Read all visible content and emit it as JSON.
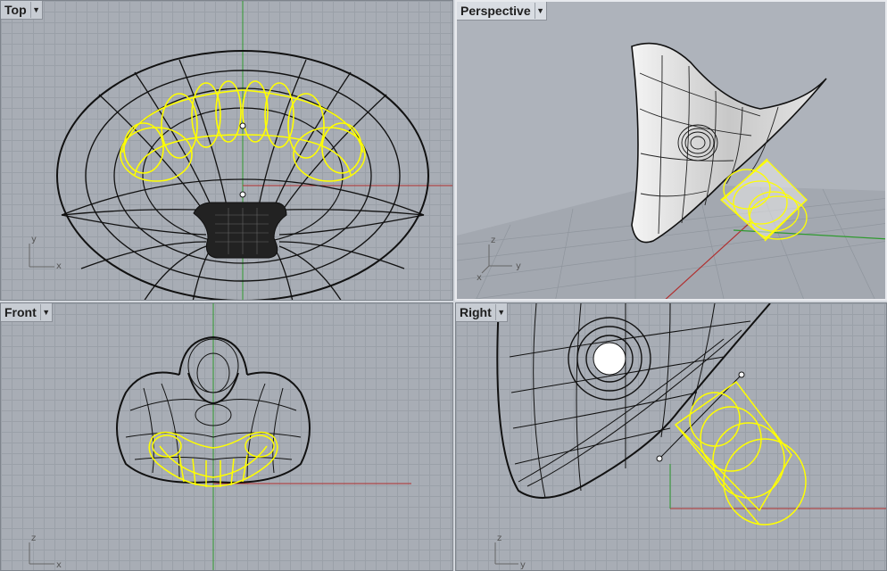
{
  "viewports": {
    "top": {
      "label": "Top",
      "menu_icon": "chevron-down-icon",
      "axes": [
        "y",
        "x"
      ]
    },
    "perspective": {
      "label": "Perspective",
      "menu_icon": "chevron-down-icon",
      "axes": [
        "z",
        "y",
        "x"
      ]
    },
    "front": {
      "label": "Front",
      "menu_icon": "chevron-down-icon",
      "axes": [
        "z",
        "x"
      ]
    },
    "right": {
      "label": "Right",
      "menu_icon": "chevron-down-icon",
      "axes": [
        "z",
        "y"
      ]
    }
  },
  "colors": {
    "grid_bg": "#a8adb5",
    "grid_line": "#9aa0a8",
    "wire_black": "#111111",
    "selection_yellow": "#ffff00",
    "axis_x_red": "#b03030",
    "axis_y_green": "#2f9a2f"
  }
}
